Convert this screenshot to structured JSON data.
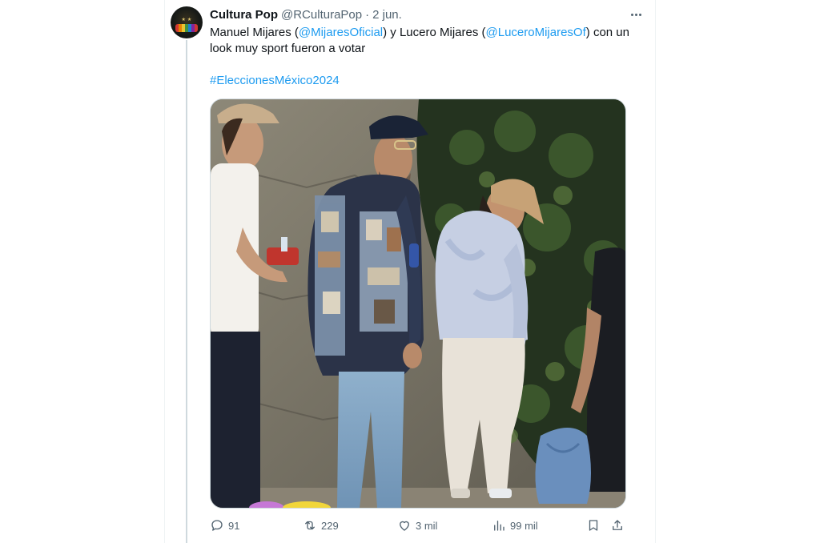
{
  "tweet": {
    "display_name": "Cultura Pop",
    "handle": "@RCulturaPop",
    "separator": "·",
    "date": "2 jun.",
    "text": {
      "part1": "Manuel Mijares (",
      "mention1": "@MijaresOficial",
      "part2": ") y Lucero Mijares (",
      "mention2": "@LuceroMijaresOf",
      "part3": ") con un look muy sport fueron a votar",
      "hashtag": "#EleccionesMéxico2024"
    }
  },
  "actions": {
    "replies": "91",
    "reposts": "229",
    "likes": "3 mil",
    "views": "99 mil"
  },
  "colors": {
    "accent": "#1d9bf0",
    "text_primary": "#0f1419",
    "text_secondary": "#536471"
  },
  "icons": {
    "reply": "reply-icon",
    "repost": "repost-icon",
    "like": "heart-icon",
    "views": "views-chart-icon",
    "bookmark": "bookmark-icon",
    "share": "share-icon",
    "more": "more-options-icon"
  }
}
